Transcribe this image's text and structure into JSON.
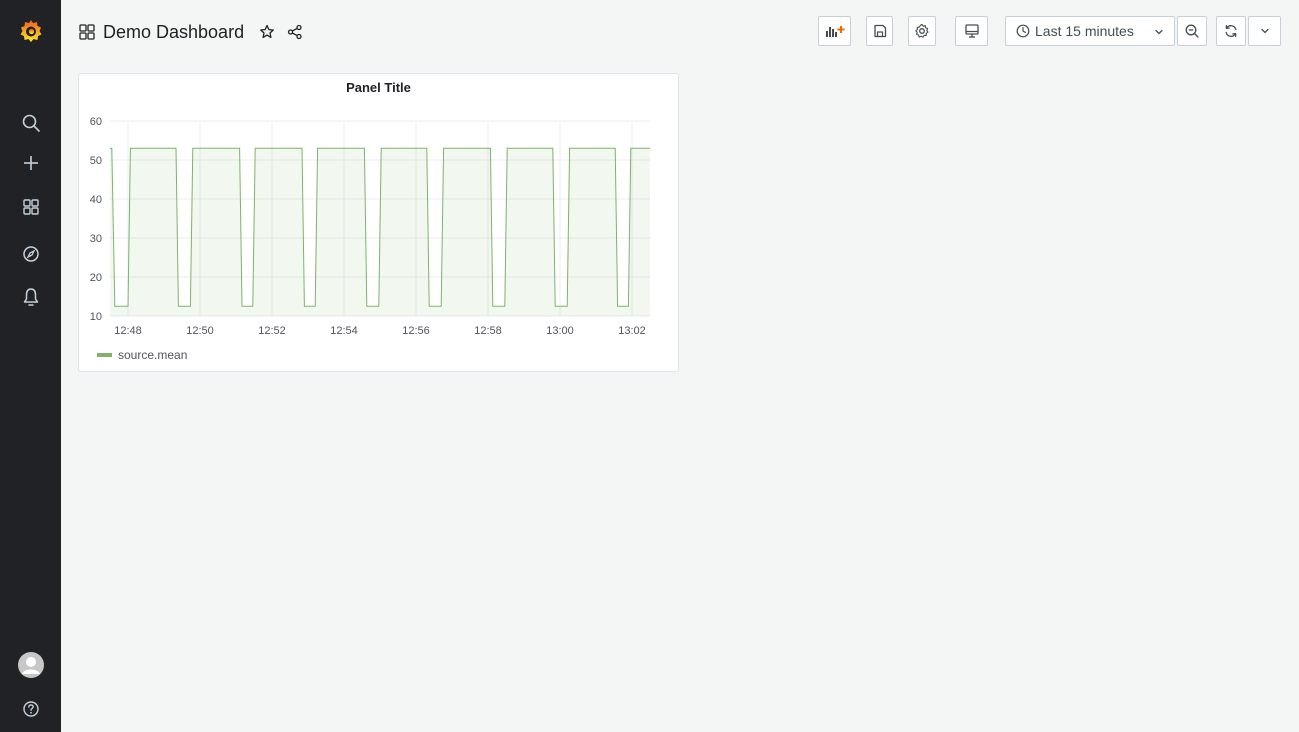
{
  "dashboard": {
    "title": "Demo Dashboard"
  },
  "time_picker": {
    "label": "Last 15 minutes"
  },
  "panel": {
    "title": "Panel Title"
  },
  "colors": {
    "series": "#7eb26d",
    "sidebar_bg": "#202226",
    "accent": "#f46800"
  },
  "icons": {
    "sidebar": [
      "grafana-logo-icon",
      "search-icon",
      "plus-icon",
      "dashboards-icon",
      "explore-compass-icon",
      "alerting-bell-icon",
      "user-avatar-icon",
      "help-icon"
    ],
    "toolbar": [
      "add-panel-icon",
      "save-icon",
      "settings-gear-icon",
      "tv-mode-icon",
      "clock-icon",
      "chevron-down-icon",
      "zoom-out-icon",
      "refresh-icon",
      "chevron-down-icon"
    ]
  },
  "chart_data": {
    "type": "line",
    "fill": true,
    "grid": true,
    "legend": "bottom-left",
    "ylim": [
      10,
      60
    ],
    "yticks": [
      10,
      20,
      30,
      40,
      50,
      60
    ],
    "xlim": [
      "12:47:30",
      "13:02:30"
    ],
    "xticks": [
      "12:48",
      "12:50",
      "12:52",
      "12:54",
      "12:56",
      "12:58",
      "13:00",
      "13:02"
    ],
    "series": [
      {
        "name": "source.mean",
        "points": [
          [
            "12:47:30",
            53
          ],
          [
            "12:47:33",
            53
          ],
          [
            "12:47:38",
            12.5
          ],
          [
            "12:48:00",
            12.5
          ],
          [
            "12:48:04",
            53
          ],
          [
            "12:49:20",
            53
          ],
          [
            "12:49:24",
            12.5
          ],
          [
            "12:49:44",
            12.5
          ],
          [
            "12:49:48",
            53
          ],
          [
            "12:51:06",
            53
          ],
          [
            "12:51:10",
            12.5
          ],
          [
            "12:51:28",
            12.5
          ],
          [
            "12:51:32",
            53
          ],
          [
            "12:52:50",
            53
          ],
          [
            "12:52:54",
            12.5
          ],
          [
            "12:53:12",
            12.5
          ],
          [
            "12:53:16",
            53
          ],
          [
            "12:54:34",
            53
          ],
          [
            "12:54:38",
            12.5
          ],
          [
            "12:54:58",
            12.5
          ],
          [
            "12:55:02",
            53
          ],
          [
            "12:56:18",
            53
          ],
          [
            "12:56:22",
            12.5
          ],
          [
            "12:56:42",
            12.5
          ],
          [
            "12:56:46",
            53
          ],
          [
            "12:58:04",
            53
          ],
          [
            "12:58:08",
            12.5
          ],
          [
            "12:58:28",
            12.5
          ],
          [
            "12:58:32",
            53
          ],
          [
            "12:59:48",
            53
          ],
          [
            "12:59:52",
            12.5
          ],
          [
            "13:00:12",
            12.5
          ],
          [
            "13:00:16",
            53
          ],
          [
            "13:01:32",
            53
          ],
          [
            "13:01:36",
            12.5
          ],
          [
            "13:01:54",
            12.5
          ],
          [
            "13:01:58",
            53
          ],
          [
            "13:02:30",
            53
          ]
        ]
      }
    ]
  }
}
